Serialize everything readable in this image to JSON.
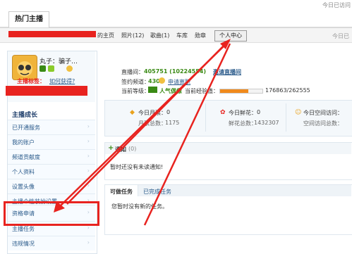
{
  "top": {
    "right_text": "今日已访问"
  },
  "tabs": {
    "hot": "热门主播"
  },
  "subnav": {
    "home": "的主页",
    "photos": "照片(12)",
    "songs": "歌曲(1)",
    "garage": "车库",
    "medals": "勋章",
    "personal_center": "个人中心",
    "today": "今日已"
  },
  "profile": {
    "name": "丸子：骗子…",
    "tag_label": "主播标签：",
    "tag_link": "如何获得?"
  },
  "sidebar": {
    "section_title": "主播成长",
    "items": [
      {
        "label": "已开通服务"
      },
      {
        "label": "我的账户"
      },
      {
        "label": "频道贡献度"
      },
      {
        "label": "个人资料"
      },
      {
        "label": "设置头像"
      },
      {
        "label": "主播个性装扮设置"
      },
      {
        "label": "资格申请"
      },
      {
        "label": "主播任务"
      },
      {
        "label": "违规情况"
      }
    ]
  },
  "info": {
    "room_label": "直播间：",
    "room_value": "405751 (10224554)",
    "room_link": "邀请直播间",
    "sign_label": "签约频道：",
    "sign_value": "430",
    "sign_link": "申请离职",
    "level_label": "当前等级：",
    "level_name": "人气偶像",
    "exp_label": "当前经验值：",
    "exp_value": "176863/262555",
    "exp_progress": 0.67
  },
  "stats": {
    "monthly_votes_label": "今日月票：",
    "monthly_votes_value": "0",
    "monthly_total_label": "月票总数：",
    "monthly_total_value": "1175",
    "flowers_label": "今日鲜花：",
    "flowers_value": "0",
    "flowers_total_label": "鲜花总数：",
    "flowers_total_value": "1432307",
    "visits_label": "今日空间访问：",
    "visits_total_label": "空间访问总数："
  },
  "notice": {
    "title": "通知",
    "count": "(0)",
    "empty": "暂时还没有未读通知!"
  },
  "tasks": {
    "tab_available": "可做任务",
    "tab_done": "已完成任务",
    "empty": "您暂时没有新的任务。"
  }
}
